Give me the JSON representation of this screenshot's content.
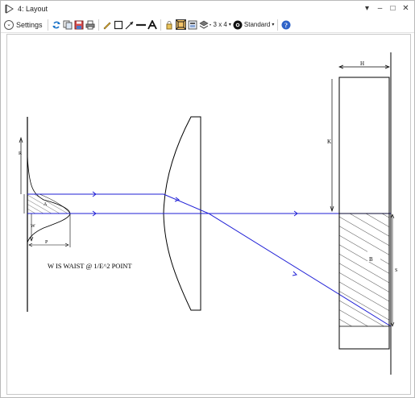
{
  "window": {
    "title": "4: Layout",
    "controls": [
      "▾",
      "–",
      "□",
      "✕"
    ]
  },
  "toolbar": {
    "settings_label": "Settings",
    "grid_label": "3 x 4",
    "standard_label": "Standard",
    "icons": [
      "refresh-icon",
      "copy-icon",
      "save-icon",
      "print-icon",
      "pencil-icon",
      "rectangle-icon",
      "arrow-icon",
      "line-icon",
      "text-icon",
      "lock-icon",
      "zoom-fit-icon",
      "export-icon",
      "layers-icon",
      "grid-icon",
      "camera-icon",
      "standard-icon",
      "help-icon"
    ]
  },
  "diagram": {
    "labels": {
      "h": "H",
      "k": "K",
      "r": "R",
      "a": "A",
      "w": "W",
      "p": "P",
      "b": "B",
      "s": "S",
      "note": "W IS WAIST @ 1/E^2 POINT"
    },
    "colors": {
      "ray": "#1f1fd6",
      "line": "#000000"
    }
  }
}
